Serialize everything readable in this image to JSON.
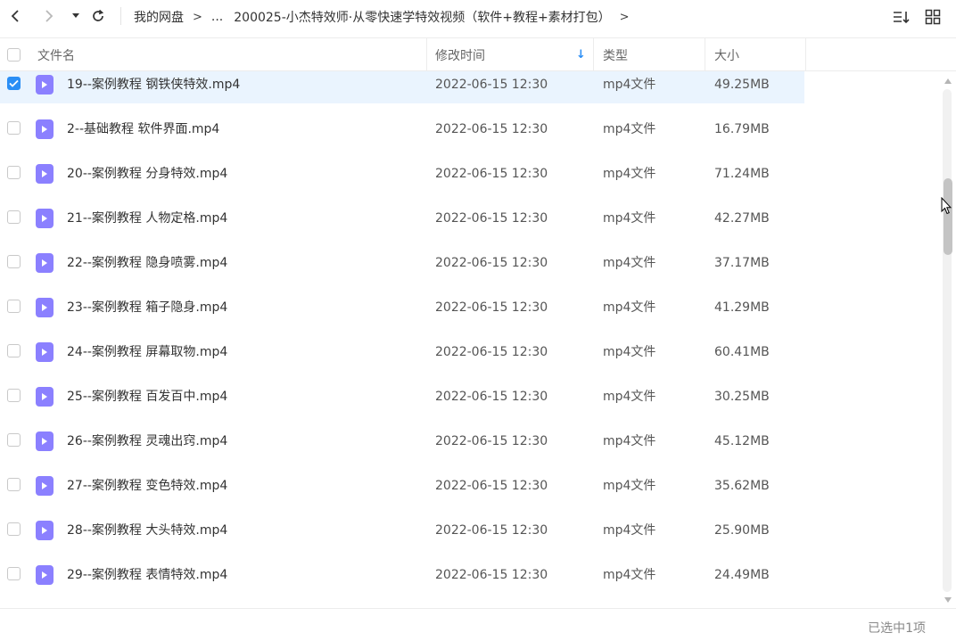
{
  "toolbar": {
    "back_icon": "chevron-left-icon",
    "forward_icon": "chevron-right-icon",
    "history_icon": "caret-down-icon",
    "refresh_icon": "refresh-icon",
    "sort_icon": "sort-list-icon",
    "grid_icon": "grid-view-icon"
  },
  "breadcrumb": {
    "items": [
      "我的网盘",
      "...",
      "200025-小杰特效师·从零快速学特效视频（软件+教程+素材打包）"
    ],
    "separator": ">"
  },
  "header": {
    "col_name": "文件名",
    "col_modified": "修改时间",
    "col_type": "类型",
    "col_size": "大小",
    "sort_indicator": "↓"
  },
  "files": [
    {
      "name": "19--案例教程 钢铁侠特效.mp4",
      "modified": "2022-06-15 12:30",
      "type": "mp4文件",
      "size": "49.25MB",
      "selected": true
    },
    {
      "name": "2--基础教程 软件界面.mp4",
      "modified": "2022-06-15 12:30",
      "type": "mp4文件",
      "size": "16.79MB",
      "selected": false
    },
    {
      "name": "20--案例教程 分身特效.mp4",
      "modified": "2022-06-15 12:30",
      "type": "mp4文件",
      "size": "71.24MB",
      "selected": false
    },
    {
      "name": "21--案例教程 人物定格.mp4",
      "modified": "2022-06-15 12:30",
      "type": "mp4文件",
      "size": "42.27MB",
      "selected": false
    },
    {
      "name": "22--案例教程 隐身喷雾.mp4",
      "modified": "2022-06-15 12:30",
      "type": "mp4文件",
      "size": "37.17MB",
      "selected": false
    },
    {
      "name": "23--案例教程 箱子隐身.mp4",
      "modified": "2022-06-15 12:30",
      "type": "mp4文件",
      "size": "41.29MB",
      "selected": false
    },
    {
      "name": "24--案例教程 屏幕取物.mp4",
      "modified": "2022-06-15 12:30",
      "type": "mp4文件",
      "size": "60.41MB",
      "selected": false
    },
    {
      "name": "25--案例教程 百发百中.mp4",
      "modified": "2022-06-15 12:30",
      "type": "mp4文件",
      "size": "30.25MB",
      "selected": false
    },
    {
      "name": "26--案例教程 灵魂出窍.mp4",
      "modified": "2022-06-15 12:30",
      "type": "mp4文件",
      "size": "45.12MB",
      "selected": false
    },
    {
      "name": "27--案例教程 变色特效.mp4",
      "modified": "2022-06-15 12:30",
      "type": "mp4文件",
      "size": "35.62MB",
      "selected": false
    },
    {
      "name": "28--案例教程 大头特效.mp4",
      "modified": "2022-06-15 12:30",
      "type": "mp4文件",
      "size": "25.90MB",
      "selected": false
    },
    {
      "name": "29--案例教程 表情特效.mp4",
      "modified": "2022-06-15 12:30",
      "type": "mp4文件",
      "size": "24.49MB",
      "selected": false
    }
  ],
  "footer": {
    "status": "已选中1项"
  },
  "colors": {
    "accent": "#2a8ef5",
    "selected_row": "#eaf4fe",
    "video_icon": "#8b80ff"
  }
}
